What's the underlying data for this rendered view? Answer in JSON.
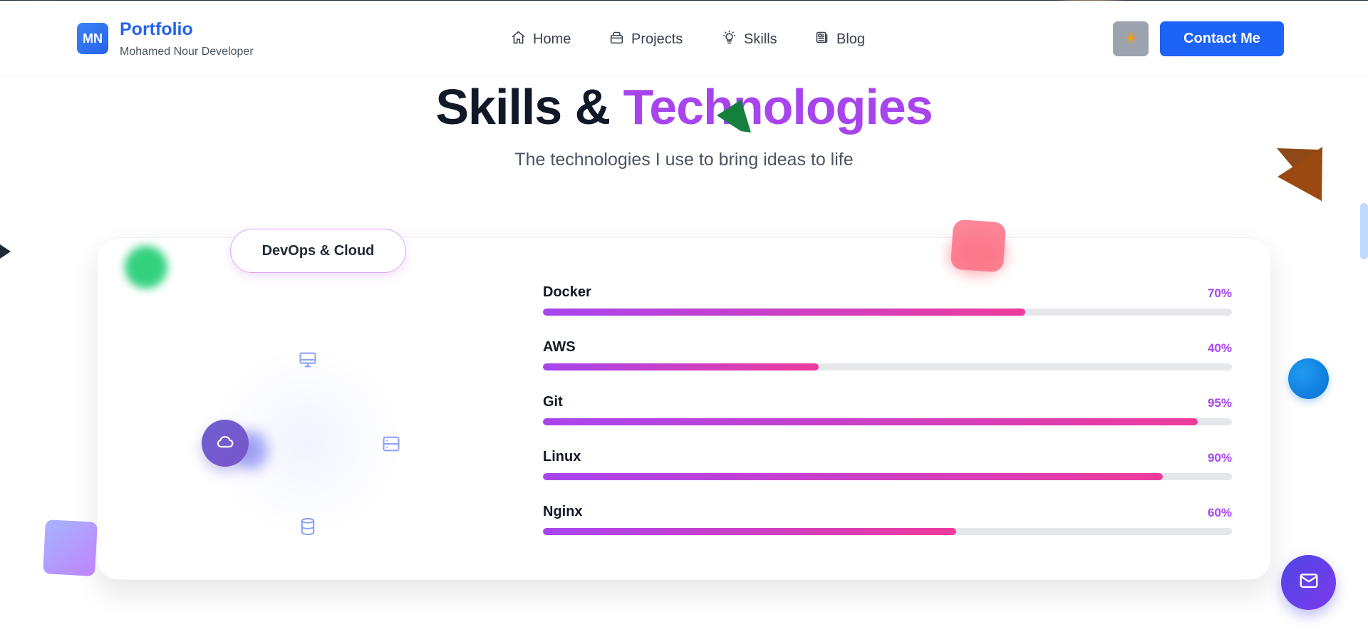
{
  "header": {
    "logo_initials": "MN",
    "brand_title": "Portfolio",
    "brand_subtitle": "Mohamed Nour Developer",
    "nav": [
      {
        "label": "Home",
        "icon": "home-icon"
      },
      {
        "label": "Projects",
        "icon": "briefcase-icon"
      },
      {
        "label": "Skills",
        "icon": "lightbulb-icon"
      },
      {
        "label": "Blog",
        "icon": "newspaper-icon"
      }
    ],
    "theme_toggle_icon": "☀",
    "contact_label": "Contact Me"
  },
  "section": {
    "title_part1": "Skills & ",
    "title_accent": "Technologies",
    "subtitle": "The technologies I use to bring ideas to life"
  },
  "card": {
    "category": "DevOps & Cloud",
    "orbit_icons": [
      "monitor-icon",
      "server-icon",
      "database-icon",
      "cloud-icon"
    ],
    "skills": [
      {
        "name": "Docker",
        "percent_label": "70%",
        "value": 70
      },
      {
        "name": "AWS",
        "percent_label": "40%",
        "value": 40
      },
      {
        "name": "Git",
        "percent_label": "95%",
        "value": 95
      },
      {
        "name": "Linux",
        "percent_label": "90%",
        "value": 90
      },
      {
        "name": "Nginx",
        "percent_label": "60%",
        "value": 60
      }
    ]
  },
  "floating_action": {
    "icon": "mail-icon"
  },
  "colors": {
    "brand_blue": "#1d63f5",
    "accent_purple": "#a844ee",
    "accent_pink": "#ee3b9c",
    "track_gray": "#e5e7eb"
  }
}
